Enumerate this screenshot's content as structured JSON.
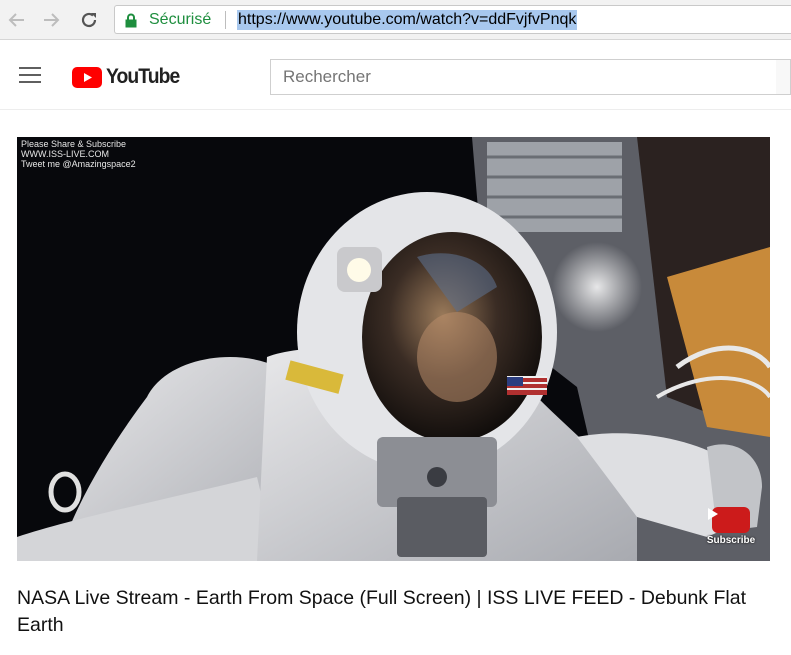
{
  "browser": {
    "secure_label": "Sécurisé",
    "url": "https://www.youtube.com/watch?v=ddFvjfvPnqk"
  },
  "masthead": {
    "logo_text": "YouTube",
    "search_placeholder": "Rechercher"
  },
  "video": {
    "overlay_lines": [
      "Please Share & Subscribe",
      "WWW.ISS-LIVE.COM",
      "Tweet me @Amazingspace2"
    ],
    "subscribe_label": "Subscribe",
    "title": "NASA Live Stream - Earth From Space (Full Screen) | ISS LIVE FEED - Debunk Flat Earth"
  },
  "colors": {
    "secure_green": "#1e8e3e",
    "youtube_red": "#ff0000",
    "url_highlight": "#a8c8ee"
  }
}
